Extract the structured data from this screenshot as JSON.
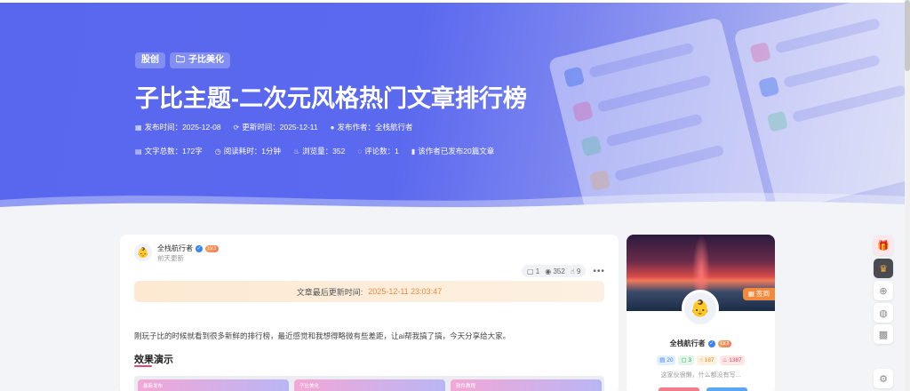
{
  "hero": {
    "tags": [
      {
        "label": "股创",
        "icon": "none"
      },
      {
        "label": "子比美化",
        "icon": "folder-icon"
      }
    ],
    "title": "子比主题-二次元风格热门文章排行榜",
    "meta_row1": [
      {
        "icon": "calendar-icon",
        "text": "发布时间：2025-12-08"
      },
      {
        "icon": "refresh-icon",
        "text": "更新时间：2025-12-11"
      },
      {
        "icon": "user-icon",
        "text": "发布作者：全栈航行者"
      }
    ],
    "meta_row2": [
      {
        "icon": "document-icon",
        "text": "文字总数：172字"
      },
      {
        "icon": "clock-icon",
        "text": "阅读耗时：1分钟"
      },
      {
        "icon": "fire-icon",
        "text": "浏览量：352"
      },
      {
        "icon": "comment-icon",
        "text": "评论数：1"
      },
      {
        "icon": "bookmark-icon",
        "text": "该作者已发布20篇文章"
      }
    ]
  },
  "post": {
    "author_name": "全栈航行者",
    "author_level": "LV.3",
    "author_sub": "前天更新",
    "stats": {
      "comments": "1",
      "views": "352",
      "likes": "9"
    },
    "notice_label": "文章最后更新时间:",
    "notice_time": "2025-12-11 23:03:47",
    "intro": "刚玩子比的时候就看到很多新鲜的排行榜，最近感觉和我想得略微有些差距，让ai帮我搞了搞，今天分享给大家。",
    "section_title": "效果演示",
    "demo_cards": [
      "最新发布",
      "子比美化",
      "软件教程"
    ]
  },
  "sidebar": {
    "signin_label": "签到",
    "name": "全栈航行者",
    "level": "LV.3",
    "badges": {
      "posts": "20",
      "comments": "3",
      "likes": "187",
      "views": "1387"
    },
    "desc": "这家伙很懒，什么都没有写..."
  },
  "colors": {
    "hero_start": "#5867ee",
    "accent_orange": "#f08a3e",
    "accent_pink": "#e0457b"
  }
}
